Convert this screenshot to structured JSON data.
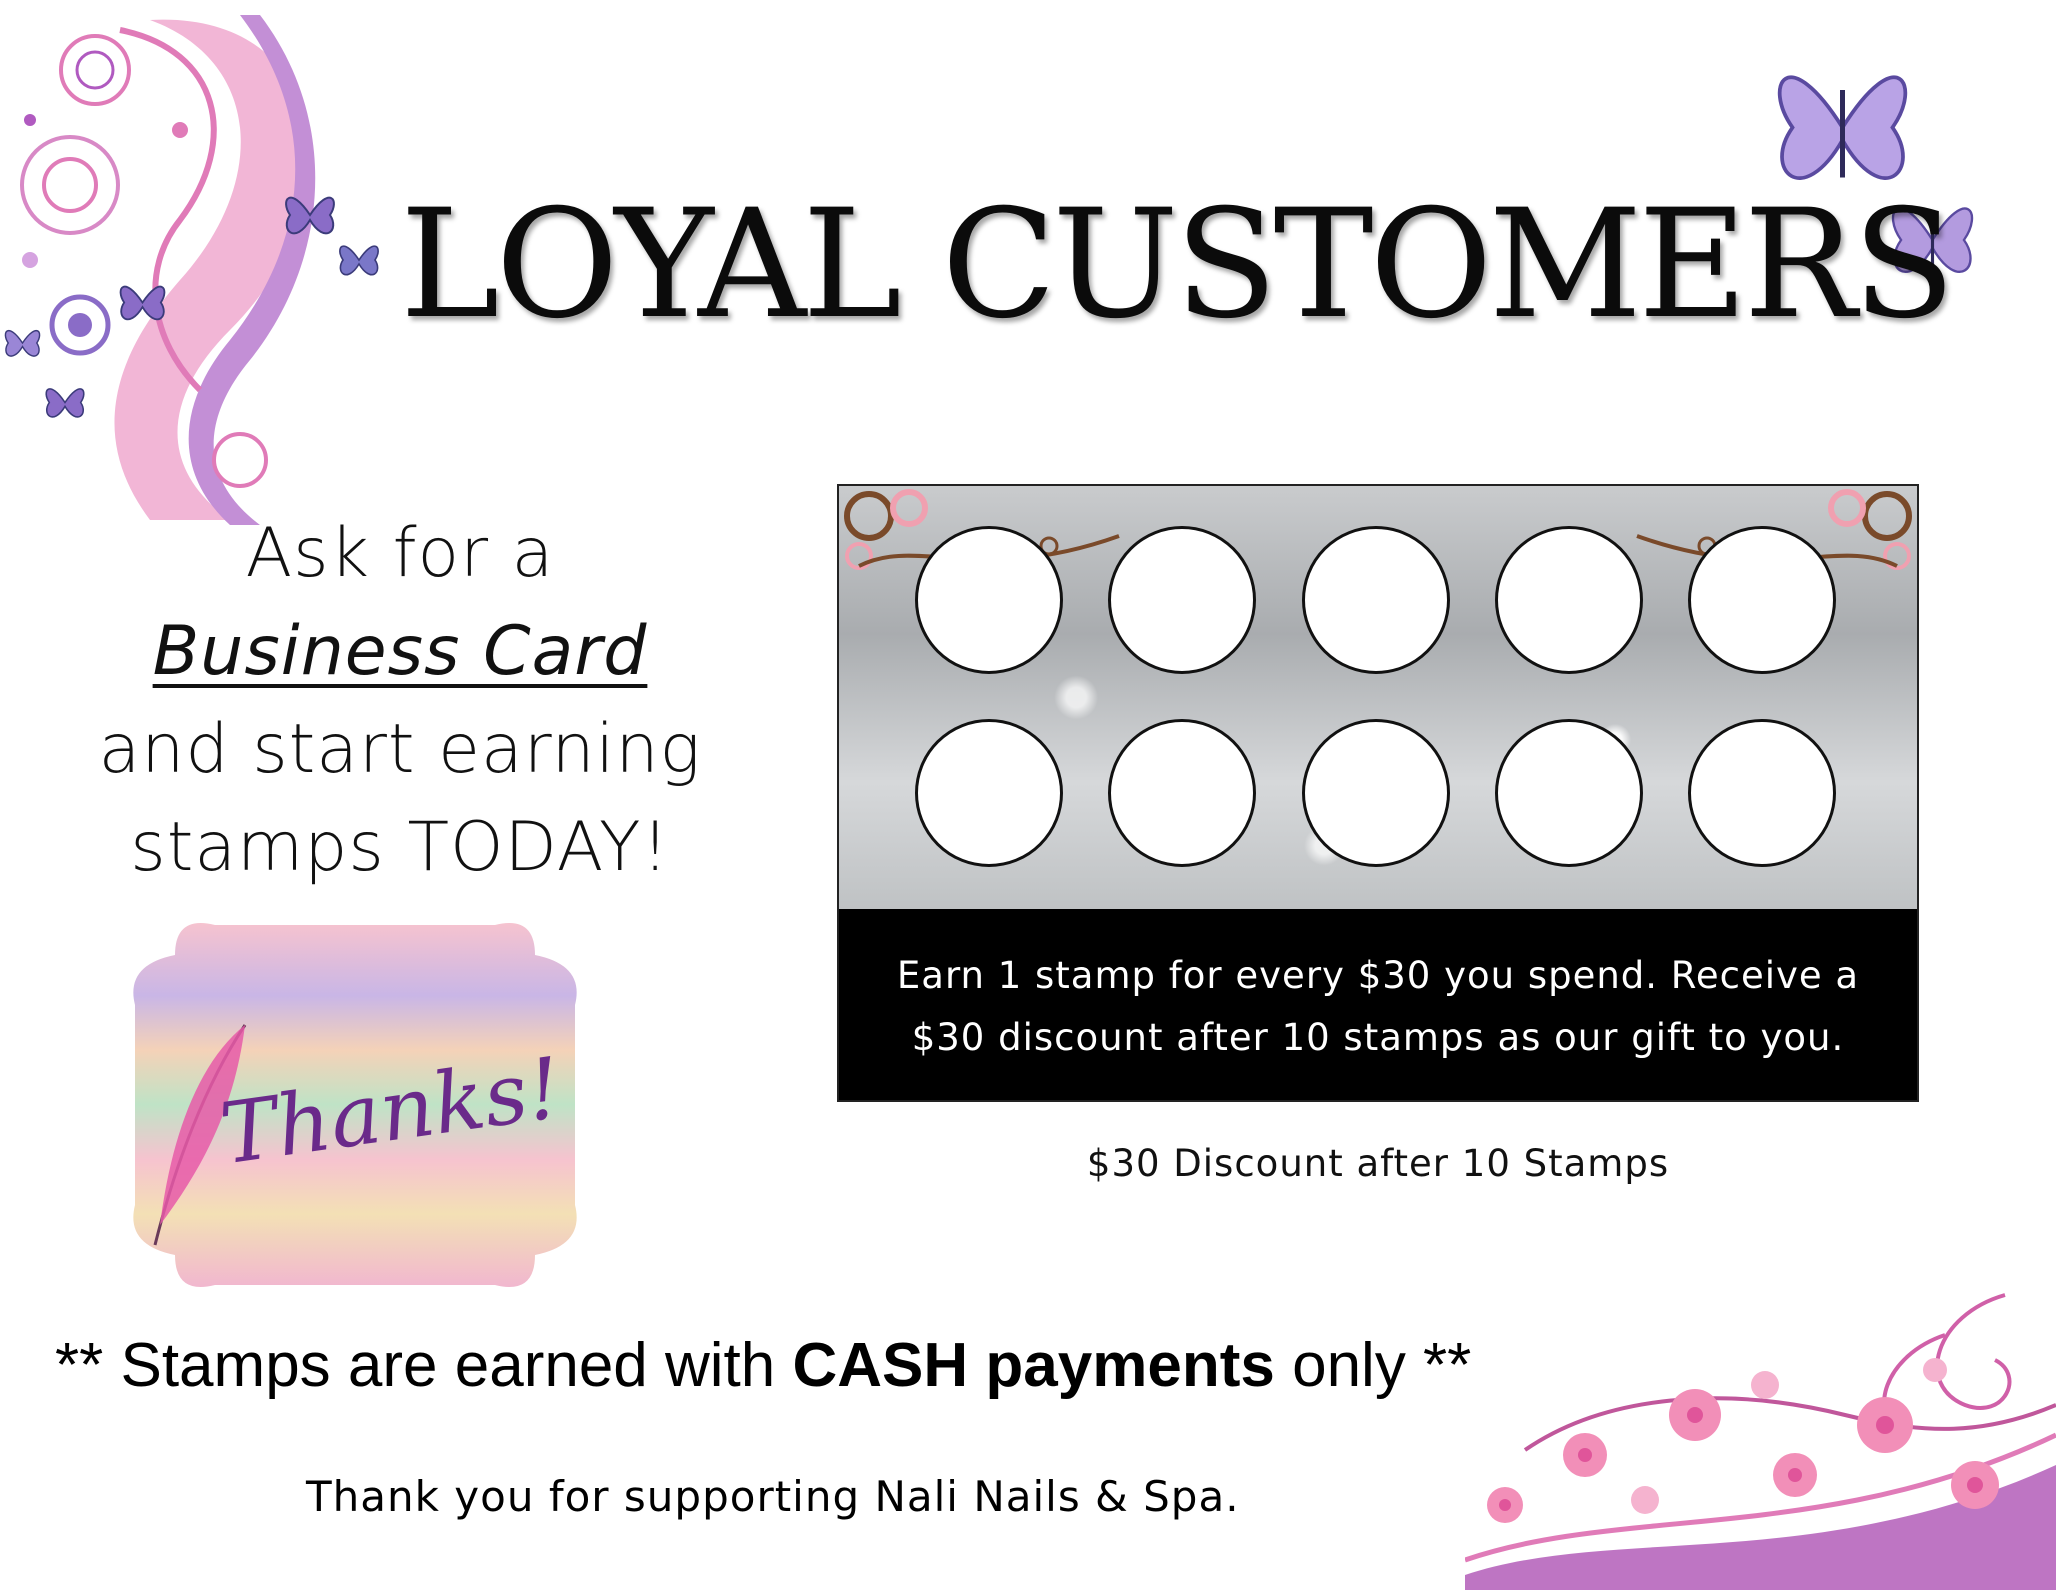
{
  "title": "LOYAL CUSTOMERS",
  "ask": {
    "line1": "Ask for a",
    "line2": "Business Card",
    "line3": "and start earning",
    "line4": "stamps TODAY!"
  },
  "card": {
    "stamp_slots": 10,
    "band_line1": "Earn 1 stamp for every $30 you spend. Receive a",
    "band_line2": "$30 discount after 10 stamps as our gift to you.",
    "caption": "$30 Discount after 10 Stamps"
  },
  "badge": {
    "text": "Thanks!"
  },
  "cash": {
    "prefix": "** Stamps are earned with ",
    "bold": "CASH payments",
    "suffix": " only  **"
  },
  "footer": {
    "text": "Thank you for supporting Nali Nails & Spa."
  },
  "colors": {
    "accent_pink": "#e07bb8",
    "accent_purple": "#9b6fd1",
    "band": "#000000"
  }
}
